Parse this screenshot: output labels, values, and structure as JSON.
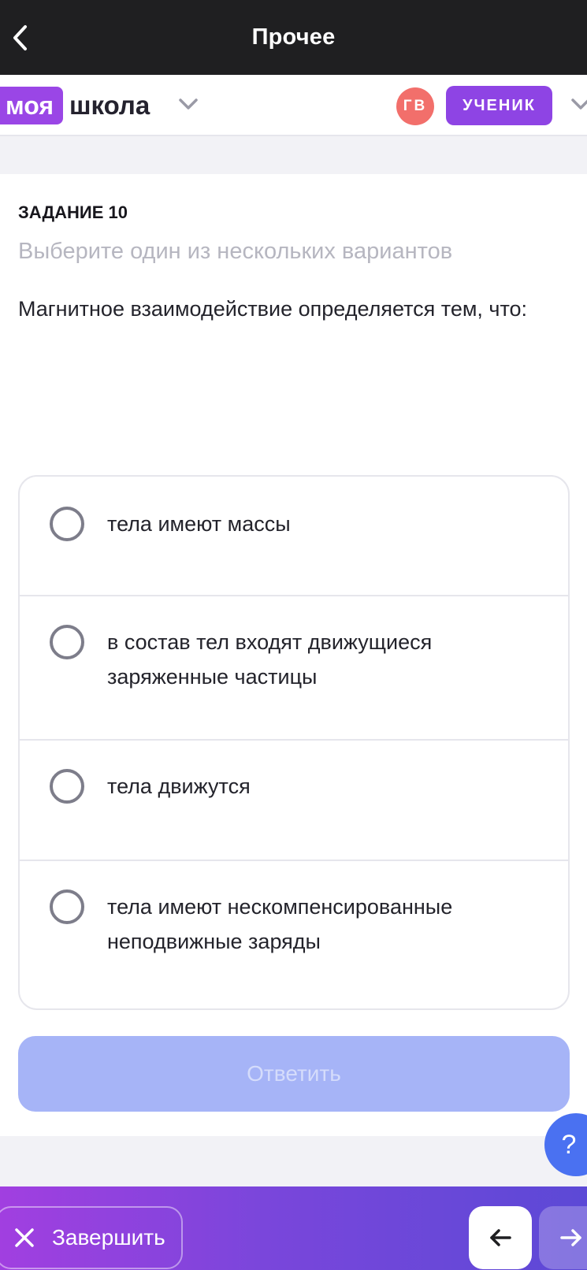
{
  "topbar": {
    "title": "Прочее",
    "back_icon": "chevron-left-icon"
  },
  "header": {
    "logo_part1": "моя",
    "logo_part2": "школа",
    "avatar_initials": "ГВ",
    "role_label": "УЧЕНИК",
    "colors": {
      "logo": "#9a46e6",
      "avatar": "#f26f6b",
      "role": "#8e44e4"
    }
  },
  "task": {
    "label": "ЗАДАНИЕ 10",
    "hint": "Выберите один из нескольких вариантов",
    "question": "Магнитное взаимодействие определяется тем, что:",
    "options": [
      {
        "text": "тела имеют массы",
        "selected": false
      },
      {
        "text": "в состав тел входят движущиеся заряженные частицы",
        "selected": false
      },
      {
        "text": "тела движутся",
        "selected": false
      },
      {
        "text": "тела имеют нескомпенсированные неподвижные заряды",
        "selected": false
      }
    ],
    "answer_label": "Ответить"
  },
  "help": {
    "label": "?"
  },
  "bottombar": {
    "finish_label": "Завершить",
    "finish_icon": "close-icon",
    "prev_icon": "arrow-left-icon",
    "next_icon": "arrow-right-icon"
  }
}
